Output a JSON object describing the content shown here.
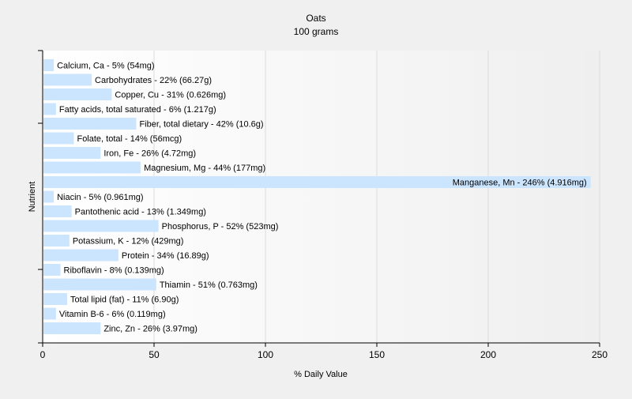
{
  "chart_data": {
    "type": "bar",
    "orientation": "horizontal",
    "title": "Oats",
    "subtitle": "100 grams",
    "xlabel": "% Daily Value",
    "ylabel": "Nutrient",
    "xlim": [
      0,
      250
    ],
    "xticks": [
      0,
      50,
      100,
      150,
      200,
      250
    ],
    "grid": "vertical",
    "bar_color": "#cce5ff",
    "background_color": "#ffffff",
    "categories": [
      "Calcium, Ca",
      "Carbohydrates",
      "Copper, Cu",
      "Fatty acids, total saturated",
      "Fiber, total dietary",
      "Folate, total",
      "Iron, Fe",
      "Magnesium, Mg",
      "Manganese, Mn",
      "Niacin",
      "Pantothenic acid",
      "Phosphorus, P",
      "Potassium, K",
      "Protein",
      "Riboflavin",
      "Thiamin",
      "Total lipid (fat)",
      "Vitamin B-6",
      "Zinc, Zn"
    ],
    "values": [
      5,
      22,
      31,
      6,
      42,
      14,
      26,
      44,
      246,
      5,
      13,
      52,
      12,
      34,
      8,
      51,
      11,
      6,
      26
    ],
    "labels": [
      "Calcium, Ca - 5% (54mg)",
      "Carbohydrates - 22% (66.27g)",
      "Copper, Cu - 31% (0.626mg)",
      "Fatty acids, total saturated - 6% (1.217g)",
      "Fiber, total dietary - 42% (10.6g)",
      "Folate, total - 14% (56mcg)",
      "Iron, Fe - 26% (4.72mg)",
      "Magnesium, Mg - 44% (177mg)",
      "Manganese, Mn - 246% (4.916mg)",
      "Niacin - 5% (0.961mg)",
      "Pantothenic acid - 13% (1.349mg)",
      "Phosphorus, P - 52% (523mg)",
      "Potassium, K - 12% (429mg)",
      "Protein - 34% (16.89g)",
      "Riboflavin - 8% (0.139mg)",
      "Thiamin - 51% (0.763mg)",
      "Total lipid (fat) - 11% (6.90g)",
      "Vitamin B-6 - 6% (0.119mg)",
      "Zinc, Zn - 26% (3.97mg)"
    ]
  }
}
